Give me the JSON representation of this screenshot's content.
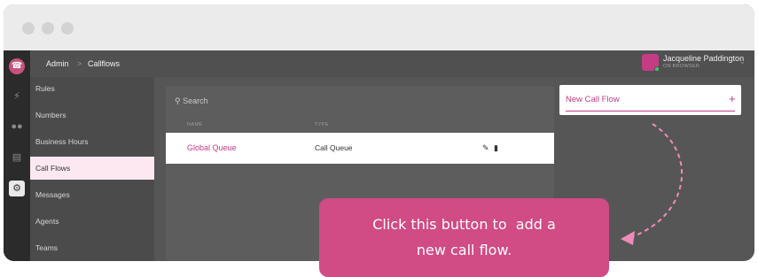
{
  "window": {
    "controls": [
      "close",
      "minimize",
      "maximize"
    ]
  },
  "rail": {
    "icons": [
      "phone-icon",
      "lightning-icon",
      "users-icon",
      "id-card-icon",
      "gear-icon"
    ]
  },
  "breadcrumb": {
    "root": "Admin",
    "separator": ">",
    "current": "Callflows"
  },
  "user": {
    "name": "Jacqueline Paddington",
    "status": "ON BROWSER"
  },
  "sidebar": {
    "items": [
      {
        "label": "Rules"
      },
      {
        "label": "Numbers"
      },
      {
        "label": "Business Hours"
      },
      {
        "label": "Call Flows"
      },
      {
        "label": "Messages"
      },
      {
        "label": "Agents"
      },
      {
        "label": "Teams"
      }
    ],
    "active_index": 3
  },
  "table": {
    "search_placeholder": "Search",
    "columns": [
      "NAME",
      "TYPE"
    ],
    "rows": [
      {
        "name": "Global Queue",
        "type": "Call Queue"
      }
    ]
  },
  "new_call_flow": {
    "label": "New Call Flow",
    "plus": "+"
  },
  "tooltip": {
    "line1": "Click this button to  add a",
    "line2": "new call flow."
  },
  "colors": {
    "accent": "#c43d84",
    "tooltip_bg": "#d14b85",
    "active_nav_bg": "#fde8f1"
  }
}
